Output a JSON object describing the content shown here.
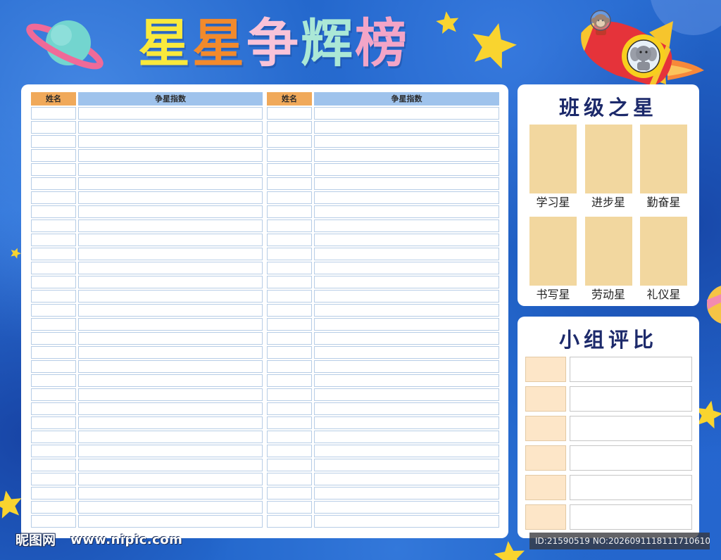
{
  "title": {
    "chars": [
      {
        "text": "星",
        "color": "#f9e93c"
      },
      {
        "text": "星",
        "color": "#f28a2c"
      },
      {
        "text": "争",
        "color": "#f9c3d8"
      },
      {
        "text": "辉",
        "color": "#abe8d6"
      },
      {
        "text": "榜",
        "color": "#f3a5c7"
      }
    ]
  },
  "score_tables": {
    "left": {
      "name_header": "姓名",
      "score_header": "争星指数"
    },
    "right": {
      "name_header": "姓名",
      "score_header": "争星指数"
    }
  },
  "class_stars": {
    "title": "班级之星",
    "awards": [
      "学习星",
      "进步星",
      "勤奋星",
      "书写星",
      "劳动星",
      "礼仪星"
    ]
  },
  "group_ranking": {
    "title": "小组评比"
  },
  "watermark": {
    "site_name": "昵图网",
    "url": "www.nipic.com",
    "image_id": "ID:21590519 NO:20260911181117106109"
  },
  "colors": {
    "background": "#2367cc",
    "name_header": "#f0a95a",
    "score_header": "#9fc3ec",
    "cell_border": "#b7cde6",
    "award_box": "#f2d79f",
    "group_label_box": "#fde6c8",
    "panel_title": "#1d2a6b",
    "star": "#f9d42f"
  },
  "decorations": [
    "ringed-planet-icon",
    "star-icon",
    "rocket-icon",
    "monkey-astronaut-icon",
    "elephant-icon",
    "distant-planet-icon"
  ]
}
